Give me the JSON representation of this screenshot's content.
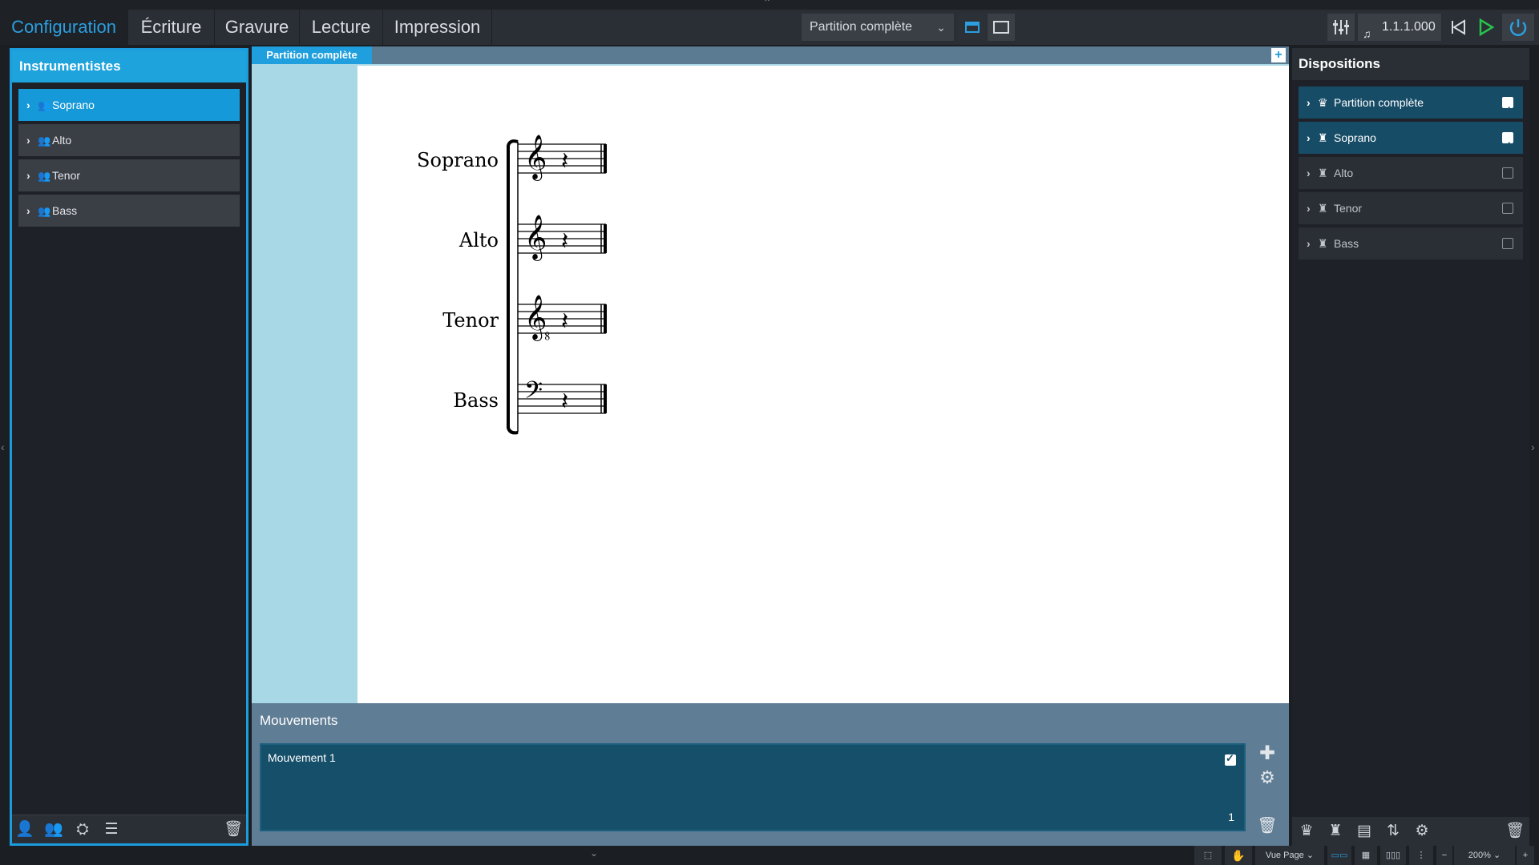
{
  "tabs": [
    {
      "label": "Configuration",
      "active": true
    },
    {
      "label": "Écriture",
      "active": false
    },
    {
      "label": "Gravure",
      "active": false
    },
    {
      "label": "Lecture",
      "active": false
    },
    {
      "label": "Impression",
      "active": false
    }
  ],
  "layout_select": {
    "value": "Partition complète"
  },
  "transport": {
    "position": "1.1.1.000"
  },
  "left_panel": {
    "title": "Instrumentistes",
    "items": [
      {
        "label": "Soprano",
        "selected": true
      },
      {
        "label": "Alto",
        "selected": false
      },
      {
        "label": "Tenor",
        "selected": false
      },
      {
        "label": "Bass",
        "selected": false
      }
    ]
  },
  "score_tab": {
    "label": "Partition complète",
    "add_label": "+"
  },
  "score": {
    "staves": [
      {
        "name": "Soprano",
        "clef": "𝄞"
      },
      {
        "name": "Alto",
        "clef": "𝄞"
      },
      {
        "name": "Tenor",
        "clef": "𝄠"
      },
      {
        "name": "Bass",
        "clef": "𝄢"
      }
    ],
    "rest_glyph": "𝄽"
  },
  "movements": {
    "title": "Mouvements",
    "items": [
      {
        "label": "Mouvement 1",
        "number": "1",
        "checked": true
      }
    ]
  },
  "right_panel": {
    "title": "Dispositions",
    "items": [
      {
        "label": "Partition complète",
        "checked": true,
        "selected": true
      },
      {
        "label": "Soprano",
        "checked": true,
        "selected": true
      },
      {
        "label": "Alto",
        "checked": false,
        "selected": false
      },
      {
        "label": "Tenor",
        "checked": false,
        "selected": false
      },
      {
        "label": "Bass",
        "checked": false,
        "selected": false
      }
    ]
  },
  "statusbar": {
    "view_mode": "Vue Page",
    "zoom": "200%"
  },
  "colors": {
    "accent": "#1ea3dc",
    "play": "#27c24c",
    "background": "#1e2228"
  }
}
